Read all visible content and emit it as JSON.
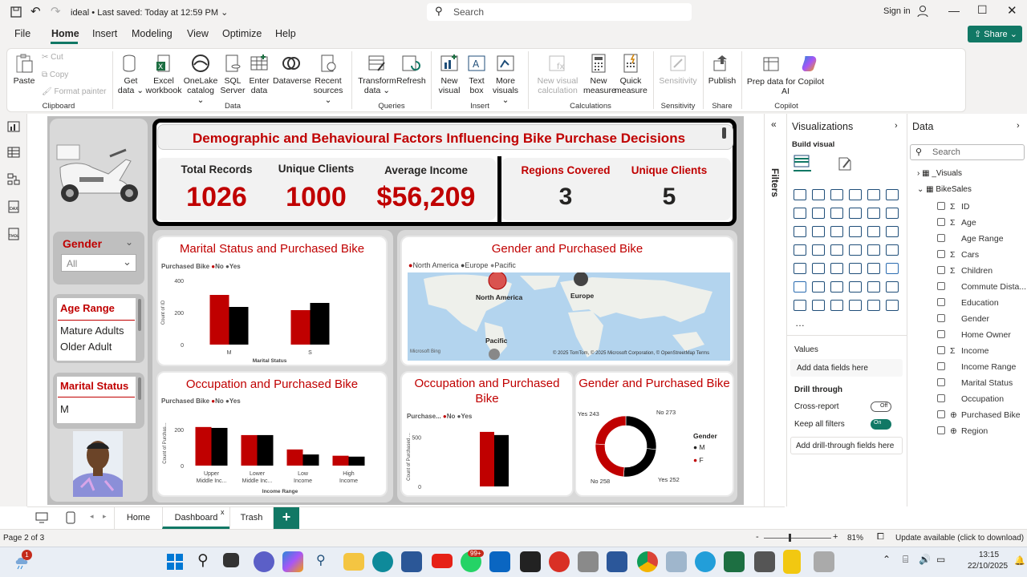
{
  "titlebar": {
    "file_name": "ideal",
    "saved": "Last saved: Today at 12:59 PM",
    "search_placeholder": "Search",
    "signin": "Sign in"
  },
  "menu": [
    "File",
    "Home",
    "Insert",
    "Modeling",
    "View",
    "Optimize",
    "Help"
  ],
  "share": "Share",
  "ribbon": {
    "paste": "Paste",
    "cut": "Cut",
    "copy": "Copy",
    "format_painter": "Format painter",
    "get_data": "Get data",
    "excel": "Excel workbook",
    "onelake": "OneLake catalog",
    "sql": "SQL Server",
    "enter_data": "Enter data",
    "dataverse": "Dataverse",
    "recent": "Recent sources",
    "transform": "Transform data",
    "refresh": "Refresh",
    "new_visual": "New visual",
    "text_box": "Text box",
    "more_visuals": "More visuals",
    "new_visual_calc": "New visual calculation",
    "new_measure": "New measure",
    "quick_measure": "Quick measure",
    "sensitivity": "Sensitivity",
    "publish": "Publish",
    "copilot": "Prep data for Copilot AI",
    "groups": {
      "clipboard": "Clipboard",
      "data": "Data",
      "queries": "Queries",
      "insert": "Insert",
      "calculations": "Calculations",
      "sensitivity": "Sensitivity",
      "share": "Share",
      "copilot": "Copilot"
    }
  },
  "report": {
    "title": "Demographic and Behavioural Factors Influencing Bike Purchase Decisions",
    "kpis": [
      {
        "label": "Total Records",
        "value": "1026"
      },
      {
        "label": "Unique Clients",
        "value": "1000"
      },
      {
        "label": "Average Income",
        "value": "$56,209"
      }
    ],
    "kpis2": [
      {
        "label": "Regions Covered",
        "value": "3"
      },
      {
        "label": "Unique Clients",
        "value": "5"
      }
    ],
    "slicers": {
      "gender_label": "Gender",
      "gender_value": "All",
      "age_label": "Age Range",
      "age_items": [
        "Mature Adults",
        "Older Adult"
      ],
      "marital_label": "Marital Status",
      "marital_item": "M"
    },
    "chart1_title": "Marital Status and Purchased Bike",
    "chart2_title": "Gender and Purchased Bike",
    "chart3_title": "Occupation and Purchased Bike",
    "chart4_title": "Occupation and Purchased Bike",
    "chart5_title": "Gender and Purchased Bike",
    "legend_label": "Purchased Bike",
    "legend_no": "No",
    "legend_yes": "Yes",
    "purchased_trunc": "Purchase...",
    "map_legend": [
      "North America",
      "Europe",
      "Pacific"
    ],
    "map_credit": "© 2025 TomTom, © 2025 Microsoft Corporation, © OpenStreetMap  Terms",
    "bing": "Microsoft Bing",
    "donut_legend_title": "Gender",
    "donut_legend": [
      "M",
      "F"
    ]
  },
  "chart_data": [
    {
      "type": "bar",
      "title": "Marital Status and Purchased Bike",
      "xlabel": "Marital Status",
      "ylabel": "Count of ID",
      "categories": [
        "M",
        "S"
      ],
      "ylim": [
        0,
        400
      ],
      "yticks": [
        "0",
        "200",
        "400"
      ],
      "series": [
        {
          "name": "No",
          "values": [
            310,
            215
          ]
        },
        {
          "name": "Yes",
          "values": [
            235,
            260
          ]
        }
      ]
    },
    {
      "type": "bar",
      "title": "Occupation and Purchased Bike",
      "xlabel": "Income Range",
      "ylabel": "Count of Purchas...",
      "categories": [
        "Upper Middle Inc...",
        "Lower Middle Inc...",
        "Low Income",
        "High Income"
      ],
      "ylim": [
        0,
        250
      ],
      "yticks": [
        "0",
        "200"
      ],
      "series": [
        {
          "name": "No",
          "values": [
            215,
            170,
            90,
            55
          ]
        },
        {
          "name": "Yes",
          "values": [
            210,
            170,
            62,
            50
          ]
        }
      ]
    },
    {
      "type": "bar",
      "title": "Occupation and Purchased Bike",
      "ylabel": "Count of Purchased ...",
      "categories": [
        ""
      ],
      "ylim": [
        0,
        600
      ],
      "yticks": [
        "0",
        "500"
      ],
      "series": [
        {
          "name": "No",
          "values": [
            552
          ]
        },
        {
          "name": "Yes",
          "values": [
            520
          ]
        }
      ]
    },
    {
      "type": "pie",
      "title": "Gender and Purchased Bike",
      "labels": [
        "No 273",
        "Yes 252",
        "No 258",
        "Yes 243"
      ],
      "values": [
        273,
        252,
        258,
        243
      ]
    }
  ],
  "filters_label": "Filters",
  "viz": {
    "title": "Visualizations",
    "build": "Build visual",
    "values": "Values",
    "add_fields": "Add data fields here",
    "drill": "Drill through",
    "cross": "Cross-report",
    "cross_state": "Off",
    "keep": "Keep all filters",
    "keep_state": "On",
    "add_drill": "Add drill-through fields here"
  },
  "data": {
    "title": "Data",
    "search": "Search",
    "tables": [
      "_Visuals",
      "BikeSales"
    ],
    "fields": [
      [
        "Σ",
        "ID"
      ],
      [
        "Σ",
        "Age"
      ],
      [
        "",
        "Age Range"
      ],
      [
        "Σ",
        "Cars"
      ],
      [
        "Σ",
        "Children"
      ],
      [
        "",
        "Commute Dista..."
      ],
      [
        "",
        "Education"
      ],
      [
        "",
        "Gender"
      ],
      [
        "",
        "Home Owner"
      ],
      [
        "Σ",
        "Income"
      ],
      [
        "",
        "Income Range"
      ],
      [
        "",
        "Marital Status"
      ],
      [
        "",
        "Occupation"
      ],
      [
        "⊕",
        "Purchased Bike"
      ],
      [
        "⊕",
        "Region"
      ]
    ]
  },
  "tabs": [
    "Home",
    "Dashboard",
    "Trash"
  ],
  "status": {
    "page": "Page 2 of 3",
    "zoom": "81%",
    "update": "Update available (click to download)"
  },
  "taskbar": {
    "time": "13:15",
    "date": "22/10/2025",
    "badge": "99+",
    "notif": "1"
  },
  "colors": {
    "red": "#c00000",
    "black": "#000000",
    "accent": "#117865"
  }
}
